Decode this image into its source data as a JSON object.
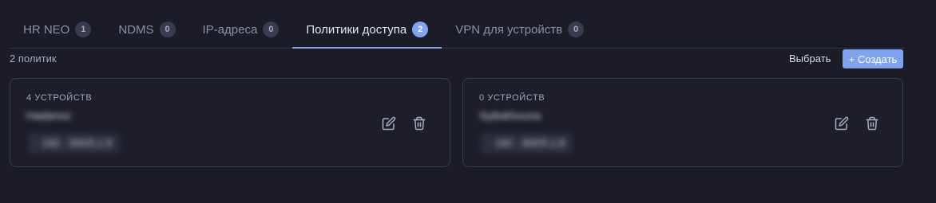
{
  "tabs": [
    {
      "label": "HR NEO",
      "count": "1",
      "active": false
    },
    {
      "label": "NDMS",
      "count": "0",
      "active": false
    },
    {
      "label": "IP-адреса",
      "count": "0",
      "active": false
    },
    {
      "label": "Политики доступа",
      "count": "2",
      "active": true
    },
    {
      "label": "VPN для устройств",
      "count": "0",
      "active": false
    }
  ],
  "toolbar": {
    "count_text": "2 политик",
    "select_label": "Выбрать",
    "create_label": "+ Создать"
  },
  "policies": [
    {
      "devices": "4 УСТРОЙСТВ",
      "name": "Hadanoz",
      "range": "· 192 · 300/5.1.8"
    },
    {
      "devices": "0 УСТРОЙСТВ",
      "name": "Syltokhouna",
      "range": "· 192 · 300/5.1.8"
    }
  ],
  "icons": {
    "edit": "edit-icon",
    "delete": "trash-icon"
  },
  "colors": {
    "background": "#1b1c25",
    "accent": "#7fa3f0",
    "card_border": "#3a3d50",
    "muted_text": "#8c90a6"
  }
}
